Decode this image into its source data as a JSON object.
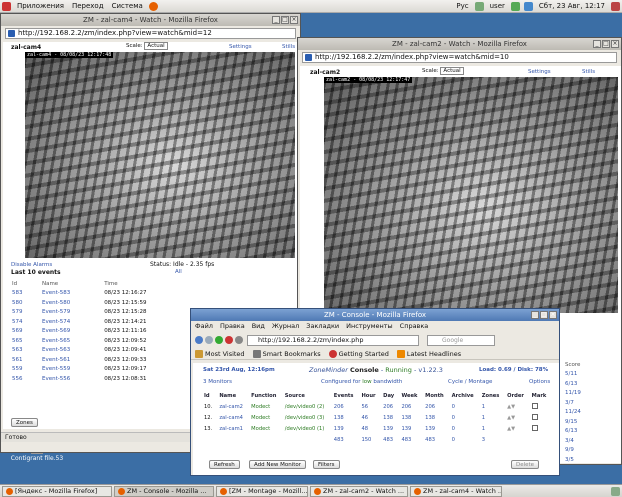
{
  "top_panel": {
    "menu": [
      "Приложения",
      "Переход",
      "Система"
    ],
    "keyboard": "Рус",
    "user": "user",
    "clock": "Сбт, 23 Авг, 12:17"
  },
  "desktop_icon": {
    "label": "Сontigrant file.53"
  },
  "win_cam4": {
    "title": "ZM - zal-cam4 - Watch - Mozilla Firefox",
    "url": "http://192.168.2.2/zm/index.php?view=watch&mid=12",
    "monitor": "zal-cam4",
    "scale_label": "Scale:",
    "scale_value": "Actual",
    "settings": "Settings",
    "stills": "Stills",
    "cam_label": "zal-cam4 - 08/08/23 12:17:48",
    "disable_alarms": "Disable Alarms",
    "status": "Status: Idle - 2.35 fps",
    "last_events": "Last 10 events",
    "all": "All",
    "headers": [
      "Id",
      "Name",
      "Time"
    ],
    "events": [
      [
        "583",
        "Event-583",
        "08/23 12:16:27"
      ],
      [
        "580",
        "Event-580",
        "08/23 12:15:59"
      ],
      [
        "579",
        "Event-579",
        "08/23 12:15:28"
      ],
      [
        "574",
        "Event-574",
        "08/23 12:14:21"
      ],
      [
        "569",
        "Event-569",
        "08/23 12:11:16"
      ],
      [
        "565",
        "Event-565",
        "08/23 12:09:52"
      ],
      [
        "563",
        "Event-563",
        "08/23 12:09:41"
      ],
      [
        "561",
        "Event-561",
        "08/23 12:09:33"
      ],
      [
        "559",
        "Event-559",
        "08/23 12:09:17"
      ],
      [
        "556",
        "Event-556",
        "08/23 12:08:31"
      ]
    ],
    "zones_btn": "Zones",
    "statusbar": "Готово"
  },
  "win_cam2": {
    "title": "ZM - zal-cam2 - Watch - Mozilla Firefox",
    "url": "http://192.168.2.2/zm/index.php?view=watch&mid=10",
    "monitor": "zal-cam2",
    "scale_label": "Scale:",
    "scale_value": "Actual",
    "settings": "Settings",
    "stills": "Stills",
    "cam_label": "zal-cam2 - 08/08/23 12:17:47"
  },
  "side_cols": {
    "head": [
      "ne",
      "Score"
    ],
    "rows": [
      [
        "27",
        "5/11"
      ],
      [
        "53",
        "6/13"
      ],
      [
        "09",
        "11/19"
      ],
      [
        "",
        "3/7"
      ],
      [
        "20",
        "11/24"
      ],
      [
        "47",
        "9/15"
      ],
      [
        "13",
        "6/13"
      ],
      [
        "13",
        "3/4"
      ],
      [
        "13",
        "9/9"
      ],
      [
        "52",
        "3/5"
      ]
    ]
  },
  "win_console": {
    "title": "ZM - Console - Mozilla Firefox",
    "menu": [
      "Файл",
      "Правка",
      "Вид",
      "Журнал",
      "Закладки",
      "Инструменты",
      "Справка"
    ],
    "url": "http://192.168.2.2/zm/index.php",
    "search_placeholder": "Google",
    "bookmarks": [
      "Most Visited",
      "Smart Bookmarks",
      "Getting Started",
      "Latest Headlines"
    ],
    "date": "Sat 23rd Aug, 12:16pm",
    "zm_title": "ZoneMinder",
    "console": "Console",
    "running": "Running",
    "version": "v1.22.3",
    "load": "Load: 0.69 / Disk: 78%",
    "monitors": "3 Monitors",
    "configured": "Configured for",
    "low": "low",
    "bandwidth": "bandwidth",
    "cycle": "Cycle / Montage",
    "options": "Options",
    "headers": [
      "Id",
      "Name",
      "Function",
      "Source",
      "Events",
      "Hour",
      "Day",
      "Week",
      "Month",
      "Archive",
      "Zones",
      "Order",
      "Mark"
    ],
    "rows": [
      [
        "10.",
        "zal-cam2",
        "Modect",
        "/dev/video0 (2)",
        "206",
        "56",
        "206",
        "206",
        "206",
        "0",
        "1"
      ],
      [
        "12.",
        "zal-cam4",
        "Modect",
        "/dev/video0 (3)",
        "138",
        "46",
        "138",
        "138",
        "138",
        "0",
        "1"
      ],
      [
        "13.",
        "zal-cam1",
        "Modect",
        "/dev/video0 (1)",
        "139",
        "48",
        "139",
        "139",
        "139",
        "0",
        "1"
      ]
    ],
    "totals": [
      "",
      "483",
      "150",
      "483",
      "483",
      "483",
      "0",
      "3"
    ],
    "buttons": {
      "refresh": "Refresh",
      "add": "Add New Monitor",
      "filters": "Filters",
      "delete": "Delete"
    }
  },
  "taskbar": [
    "[Яндекс - Mozilla Firefox]",
    "ZM - Console - Mozilla ...",
    "[ZM - Montage - Mozill...",
    "ZM - zal-cam2 - Watch ...",
    "ZM - zal-cam4 - Watch ..."
  ]
}
